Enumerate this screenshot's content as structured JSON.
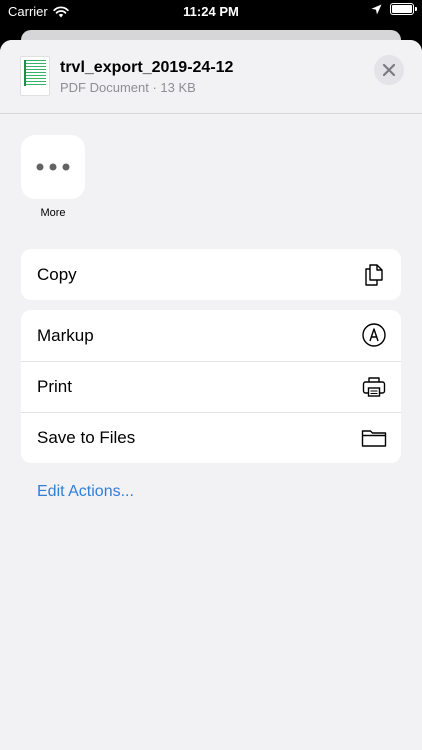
{
  "status_bar": {
    "carrier": "Carrier",
    "time": "11:24 PM"
  },
  "file": {
    "name": "trvl_export_2019-24-12",
    "meta": "PDF Document · 13 KB"
  },
  "more": {
    "label": "More"
  },
  "actions": {
    "copy": {
      "label": "Copy",
      "icon": "copy-icon"
    },
    "markup": {
      "label": "Markup",
      "icon": "markup-icon"
    },
    "print": {
      "label": "Print",
      "icon": "printer-icon"
    },
    "save_to_files": {
      "label": "Save to Files",
      "icon": "folder-icon"
    }
  },
  "edit_actions": {
    "label": "Edit Actions..."
  },
  "colors": {
    "link": "#2f7fd6",
    "sheet_bg": "#f2f2f4",
    "text_secondary": "#8e8e93"
  }
}
